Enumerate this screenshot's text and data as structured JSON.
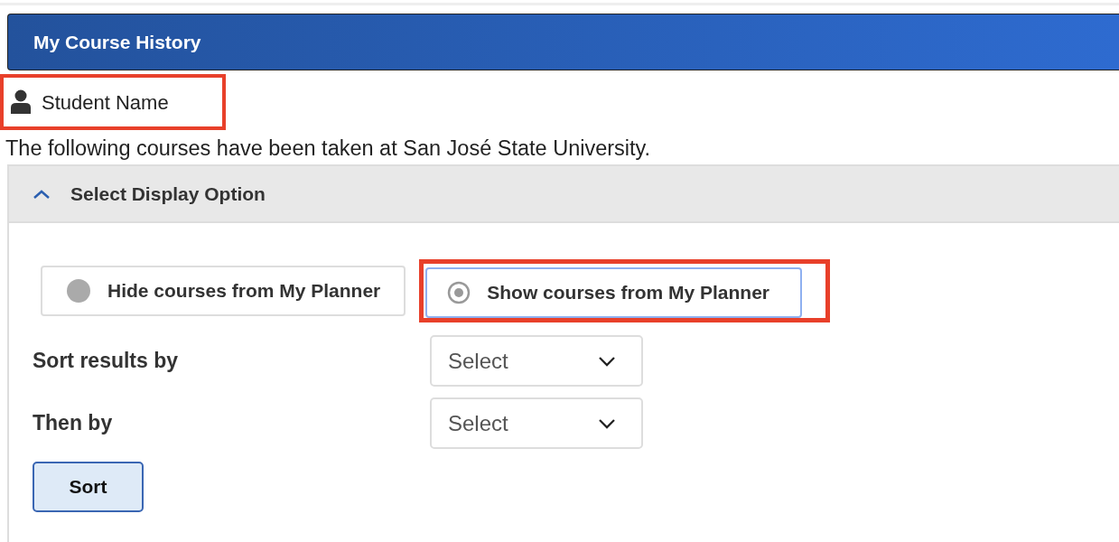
{
  "header": {
    "title": "My Course History"
  },
  "student": {
    "name": "Student Name",
    "highlighted": true
  },
  "intro": "The following courses have been taken at San José State University.",
  "panel": {
    "title": "Select Display Option",
    "expanded": true,
    "options": [
      {
        "label": "Hide courses from My Planner",
        "selected": false,
        "highlighted": false
      },
      {
        "label": "Show courses from My Planner",
        "selected": true,
        "highlighted": true
      }
    ],
    "sorts": [
      {
        "label": "Sort results by",
        "value": "Select"
      },
      {
        "label": "Then by",
        "value": "Select"
      }
    ],
    "button": "Sort"
  }
}
